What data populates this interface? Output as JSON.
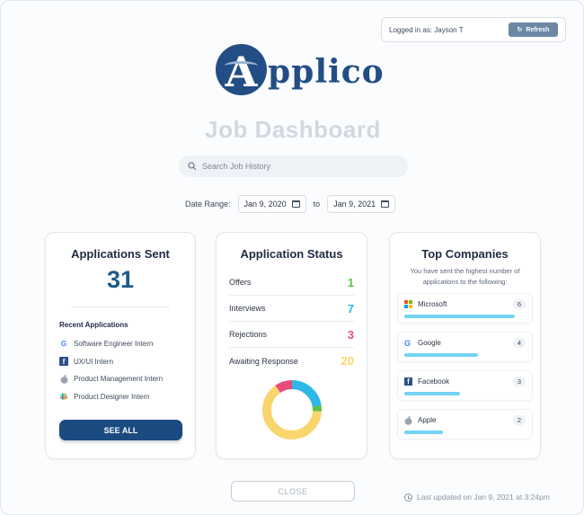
{
  "session": {
    "logged_in_text": "Logged in as: Jayson T",
    "refresh_label": "Refresh"
  },
  "brand": {
    "logo_letter": "A",
    "logo_rest": "pplico"
  },
  "page": {
    "title": "Job Dashboard"
  },
  "search": {
    "placeholder": "Search Job History",
    "value": ""
  },
  "date_range": {
    "label": "Date Range:",
    "from": "Jan 9, 2020",
    "separator": "to",
    "to": "Jan 9, 2021"
  },
  "applications": {
    "title": "Applications Sent",
    "count": "31",
    "recent_title": "Recent Applications",
    "recent": [
      {
        "label": "Software Engineer Intern",
        "icon": "google-icon"
      },
      {
        "label": "UX/UI Intern",
        "icon": "facebook-icon"
      },
      {
        "label": "Product Management Intern",
        "icon": "apple-icon"
      },
      {
        "label": "Product Designer Intern",
        "icon": "slack-icon"
      }
    ],
    "see_all_label": "SEE ALL"
  },
  "status": {
    "title": "Application Status",
    "rows": [
      {
        "label": "Offers",
        "value": "1",
        "color": "#5cbf4a"
      },
      {
        "label": "Interviews",
        "value": "7",
        "color": "#2eb7e8"
      },
      {
        "label": "Rejections",
        "value": "3",
        "color": "#e84d7a"
      },
      {
        "label": "Awaiting Response",
        "value": "20",
        "color": "#f9d56e"
      }
    ]
  },
  "companies": {
    "title": "Top Companies",
    "subtitle": "You have sent the highest number of applications to the following:",
    "rows": [
      {
        "name": "Microsoft",
        "count": "6",
        "fraction": 1.0,
        "icon": "microsoft-icon"
      },
      {
        "name": "Google",
        "count": "4",
        "fraction": 0.667,
        "icon": "google-icon"
      },
      {
        "name": "Facebook",
        "count": "3",
        "fraction": 0.5,
        "icon": "facebook-icon"
      },
      {
        "name": "Apple",
        "count": "2",
        "fraction": 0.35,
        "icon": "apple-icon"
      }
    ]
  },
  "footer": {
    "close_label": "CLOSE",
    "updated_text": "Last updated on Jan 9, 2021 at 3:24pm"
  }
}
